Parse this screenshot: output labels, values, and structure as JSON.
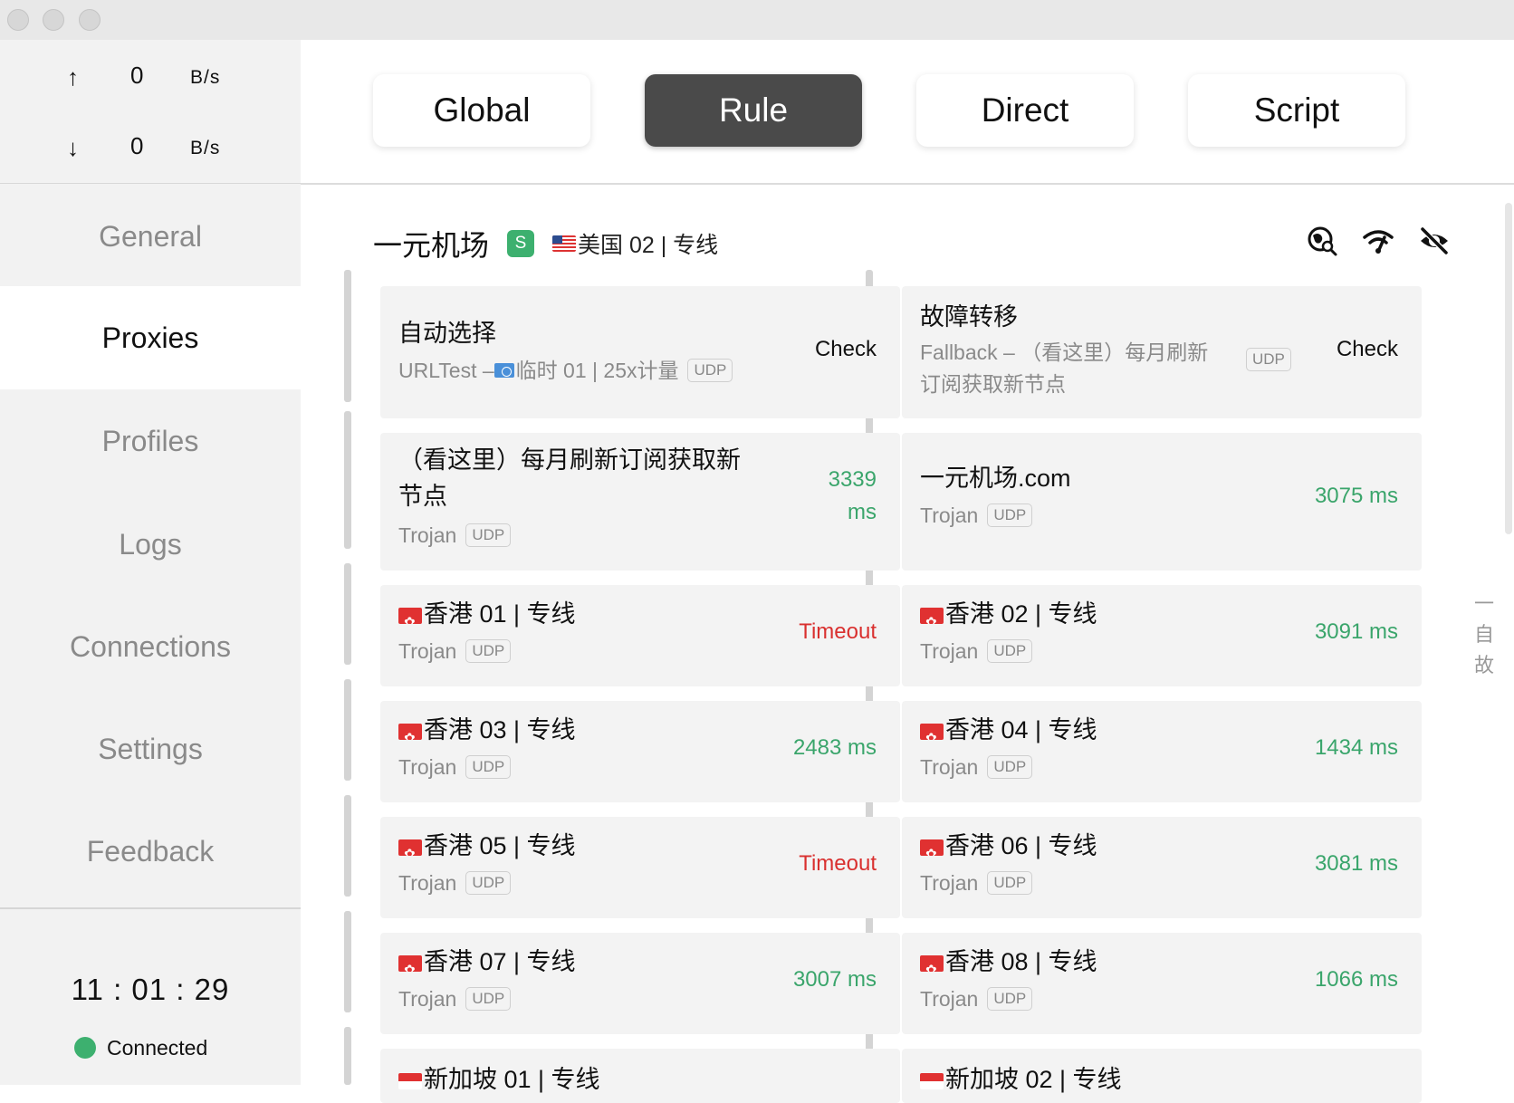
{
  "speed": {
    "up_arrow": "↑",
    "up_value": "0",
    "up_unit": "B/s",
    "down_arrow": "↓",
    "down_value": "0",
    "down_unit": "B/s"
  },
  "nav": [
    "General",
    "Proxies",
    "Profiles",
    "Logs",
    "Connections",
    "Settings",
    "Feedback"
  ],
  "active_nav": "Proxies",
  "clock": "11 : 01 : 29",
  "status": "Connected",
  "modes": [
    "Global",
    "Rule",
    "Direct",
    "Script"
  ],
  "active_mode": "Rule",
  "group": {
    "name": "一元机场",
    "badge": "S",
    "selected": "美国 02 | 专线"
  },
  "header_icons": [
    "search-location-icon",
    "wifi-speed-icon",
    "eye-off-icon"
  ],
  "cards": [
    {
      "title": "自动选择",
      "sub": "URLTest – ",
      "sub_flag": "un",
      "sub_extra": "临时 01 | 25x计量",
      "udp": "UDP",
      "right": "Check",
      "kind": "check"
    },
    {
      "title": "故障转移",
      "sub": "Fallback – （看这里）每月刷新",
      "sub2": "订阅获取新节点",
      "udp": "UDP",
      "right": "Check",
      "kind": "check"
    },
    {
      "title": "（看这里）每月刷新订阅获取新",
      "title2": "节点",
      "sub": "Trojan",
      "udp": "UDP",
      "right": "3339",
      "right2": "ms",
      "kind": "ok"
    },
    {
      "title": "一元机场.com",
      "sub": "Trojan",
      "udp": "UDP",
      "right": "3075 ms",
      "kind": "ok"
    },
    {
      "title": "香港 01 | 专线",
      "flag": "hk",
      "sub": "Trojan",
      "udp": "UDP",
      "right": "Timeout",
      "kind": "timeout"
    },
    {
      "title": "香港 02 | 专线",
      "flag": "hk",
      "sub": "Trojan",
      "udp": "UDP",
      "right": "3091 ms",
      "kind": "ok"
    },
    {
      "title": "香港 03 | 专线",
      "flag": "hk",
      "sub": "Trojan",
      "udp": "UDP",
      "right": "2483 ms",
      "kind": "ok"
    },
    {
      "title": "香港 04 | 专线",
      "flag": "hk",
      "sub": "Trojan",
      "udp": "UDP",
      "right": "1434 ms",
      "kind": "ok"
    },
    {
      "title": "香港 05 | 专线",
      "flag": "hk",
      "sub": "Trojan",
      "udp": "UDP",
      "right": "Timeout",
      "kind": "timeout"
    },
    {
      "title": "香港 06 | 专线",
      "flag": "hk",
      "sub": "Trojan",
      "udp": "UDP",
      "right": "3081 ms",
      "kind": "ok"
    },
    {
      "title": "香港 07 | 专线",
      "flag": "hk",
      "sub": "Trojan",
      "udp": "UDP",
      "right": "3007 ms",
      "kind": "ok"
    },
    {
      "title": "香港 08 | 专线",
      "flag": "hk",
      "sub": "Trojan",
      "udp": "UDP",
      "right": "1066 ms",
      "kind": "ok"
    },
    {
      "title": "新加坡 01 | 专线",
      "flag": "sg",
      "kind": "partial"
    },
    {
      "title": "新加坡 02 | 专线",
      "flag": "sg",
      "kind": "partial"
    }
  ],
  "side_index": [
    "一",
    "自",
    "故"
  ],
  "colors": {
    "ok": "#3aa56b",
    "timeout": "#d9302f",
    "badge": "#3db06f",
    "active_mode": "#4a4a4a"
  }
}
